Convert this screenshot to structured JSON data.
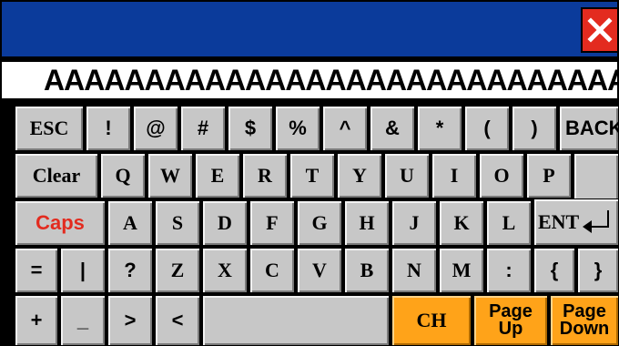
{
  "window": {
    "close_label": "X"
  },
  "display": {
    "value": "AAAAAAAAAAAAAAAAAAAAAAAAAAAAAAAAAAAA"
  },
  "keys": {
    "esc": "ESC",
    "excl": "!",
    "at": "@",
    "hash": "#",
    "dollar": "$",
    "percent": "%",
    "caret": "^",
    "amp": "&",
    "star": "*",
    "lparen": "(",
    "rparen": ")",
    "back": "BACK",
    "clear": "Clear",
    "q": "Q",
    "w": "W",
    "e": "E",
    "r": "R",
    "t": "T",
    "y": "Y",
    "u": "U",
    "i": "I",
    "o": "O",
    "p": "P",
    "caps": "Caps",
    "a": "A",
    "s": "S",
    "d": "D",
    "f": "F",
    "g": "G",
    "h": "H",
    "j": "J",
    "k": "K",
    "l": "L",
    "enter": "ENT",
    "equals": "=",
    "pipe": "|",
    "question": "?",
    "z": "Z",
    "x": "X",
    "c": "C",
    "v": "V",
    "b": "B",
    "n": "N",
    "m": "M",
    "colon": ":",
    "lbrace": "{",
    "rbrace": "}",
    "plus": "+",
    "underscore": "_",
    "gt": ">",
    "lt": "<",
    "ch": "CH",
    "page_up": [
      "Page",
      "Up"
    ],
    "page_down": [
      "Page",
      "Down"
    ]
  },
  "colors": {
    "titlebar": "#0b3b9b",
    "close": "#e32b1f",
    "key": "#c7c7c7",
    "accent_orange": "#ffa319",
    "caps_text": "#e32b1f"
  }
}
